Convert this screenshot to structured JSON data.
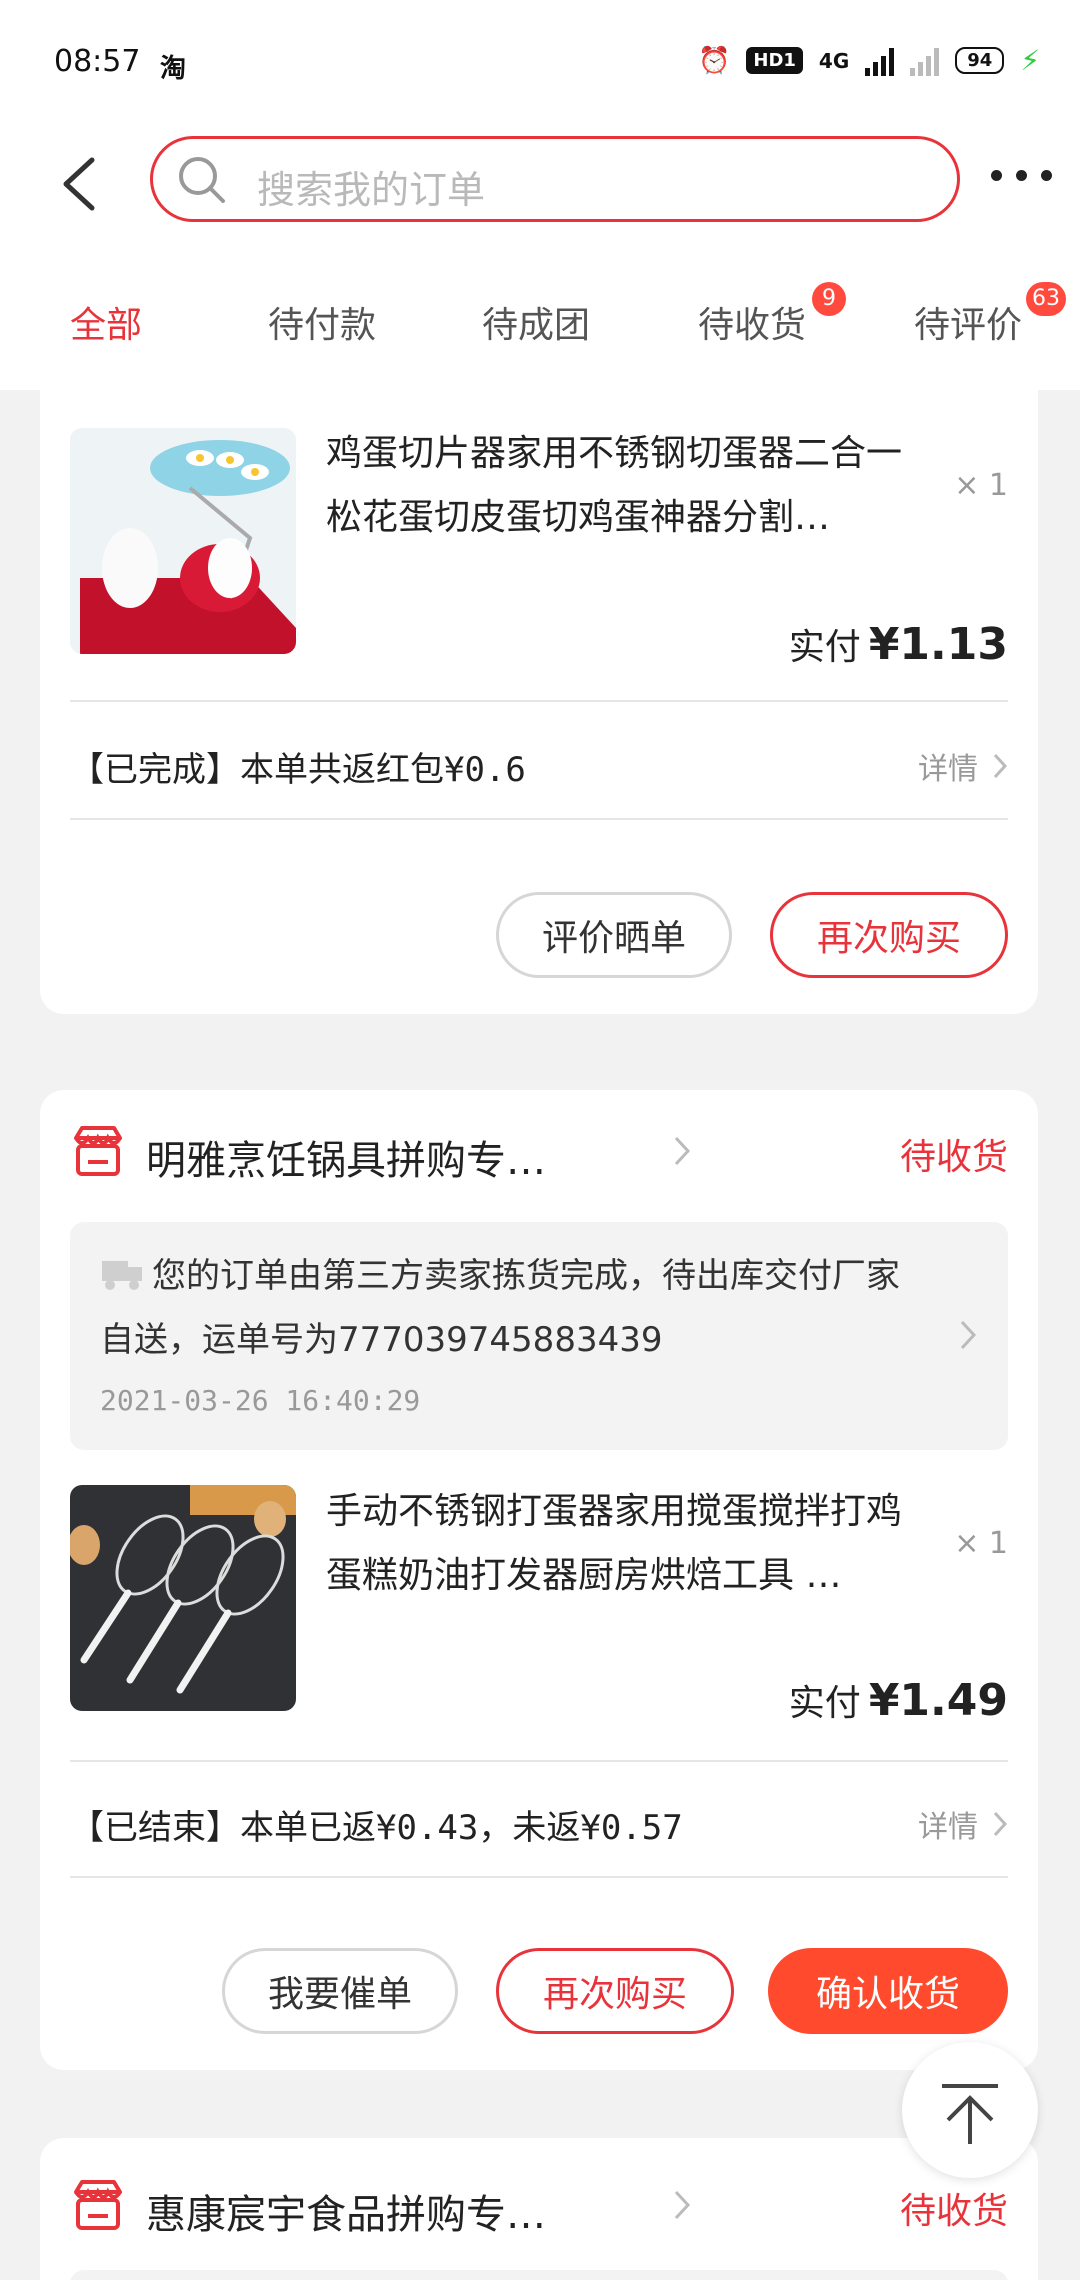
{
  "status_bar": {
    "time": "08:57",
    "app_label": "淘",
    "network": "4G",
    "hd_label": "HD1",
    "battery": "94"
  },
  "header": {
    "search_placeholder": "搜索我的订单"
  },
  "tabs": [
    {
      "label": "全部",
      "active": true
    },
    {
      "label": "待付款"
    },
    {
      "label": "待成团"
    },
    {
      "label": "待收货",
      "badge": "9"
    },
    {
      "label": "待评价",
      "badge": "63"
    }
  ],
  "orders": [
    {
      "product_title": "鸡蛋切片器家用不锈钢切蛋器二合一松花蛋切皮蛋切鸡蛋神器分割…",
      "quantity": "× 1",
      "paid_label": "实付",
      "paid_amount": "¥1.13",
      "rebate_text": "【已完成】本单共返红包¥0.6",
      "detail_label": "详情",
      "buttons": [
        "评价晒单",
        "再次购买"
      ]
    },
    {
      "store_name": "明雅烹饪锅具拼购专…",
      "status": "待收货",
      "logistics_text": "您的订单由第三方卖家拣货完成，待出库交付厂家自送，运单号为777039745883439",
      "logistics_time": "2021-03-26 16:40:29",
      "product_title": "手动不锈钢打蛋器家用搅蛋搅拌打鸡蛋糕奶油打发器厨房烘焙工具 …",
      "quantity": "× 1",
      "paid_label": "实付",
      "paid_amount": "¥1.49",
      "rebate_text": "【已结束】本单已返¥0.43，未返¥0.57",
      "detail_label": "详情",
      "buttons": [
        "我要催单",
        "再次购买",
        "确认收货"
      ]
    },
    {
      "store_name": "惠康宸宇食品拼购专…",
      "status": "待收货"
    }
  ],
  "colors": {
    "accent": "#e8333a",
    "confirm_button": "#ff4a2d",
    "badge": "#ff4a3d"
  }
}
